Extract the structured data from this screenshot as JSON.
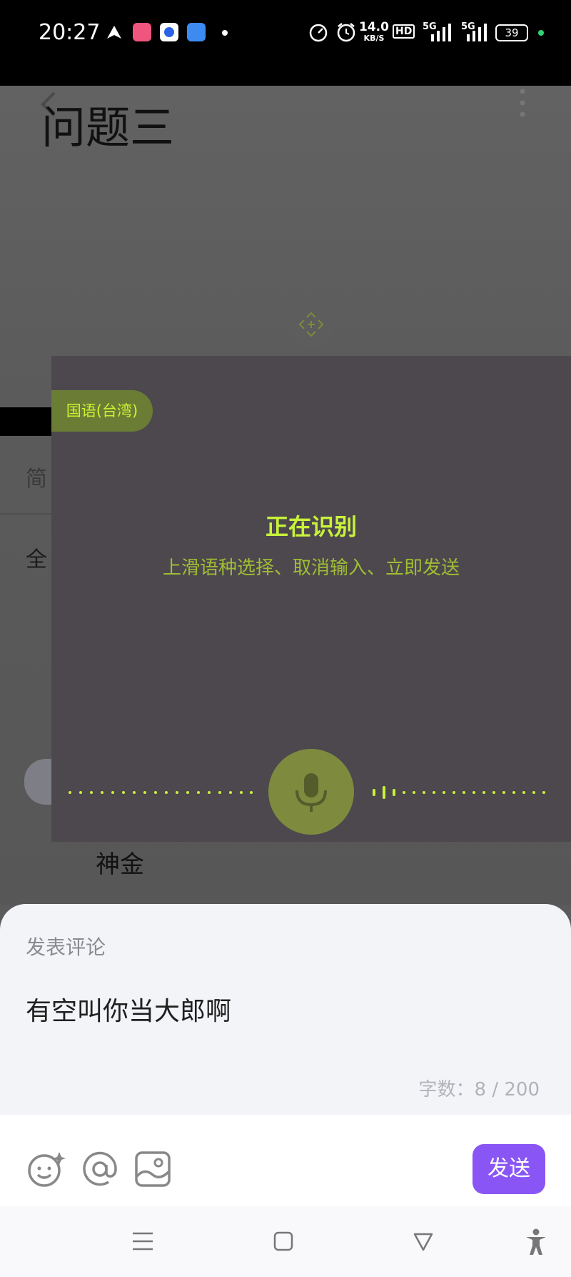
{
  "status_bar": {
    "time": "20:27",
    "net_speed": "14.0",
    "net_unit": "KB/S",
    "hd_label": "HD",
    "signal1_label": "5G",
    "signal2_label": "5G",
    "battery": "39"
  },
  "page": {
    "title": "问题三",
    "frag_1": "简",
    "frag_2": "全",
    "username": "神金"
  },
  "voice": {
    "language": "国语(台湾)",
    "status": "正在识别",
    "hint": "上滑语种选择、取消输入、立即发送"
  },
  "comment": {
    "label": "发表评论",
    "text": "有空叫你当大郎啊",
    "counter": "字数：8 / 200",
    "send_label": "发送"
  },
  "colors": {
    "accent": "#8956f5",
    "voice_green": "#c8f23a",
    "chip_bg": "#6b7d35"
  }
}
